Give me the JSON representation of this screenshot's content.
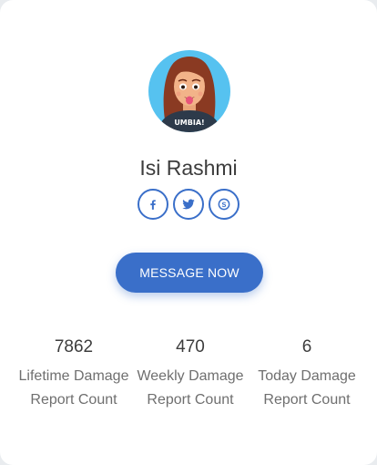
{
  "profile": {
    "name": "Isi Rashmi",
    "avatar_shirt_text": "UMBIA!"
  },
  "socials": [
    {
      "icon": "facebook-icon"
    },
    {
      "icon": "twitter-icon"
    },
    {
      "icon": "skype-icon"
    }
  ],
  "actions": {
    "message_label": "MESSAGE NOW"
  },
  "stats": [
    {
      "value": "7862",
      "label": "Lifetime Damage Report Count"
    },
    {
      "value": "470",
      "label": "Weekly Damage Report Count"
    },
    {
      "value": "6",
      "label": "Today Damage Report Count"
    }
  ],
  "colors": {
    "accent": "#3a6fc9",
    "avatar_bg": "#56c2f0",
    "text": "#3d3d3d",
    "muted": "#6f6f6f"
  }
}
